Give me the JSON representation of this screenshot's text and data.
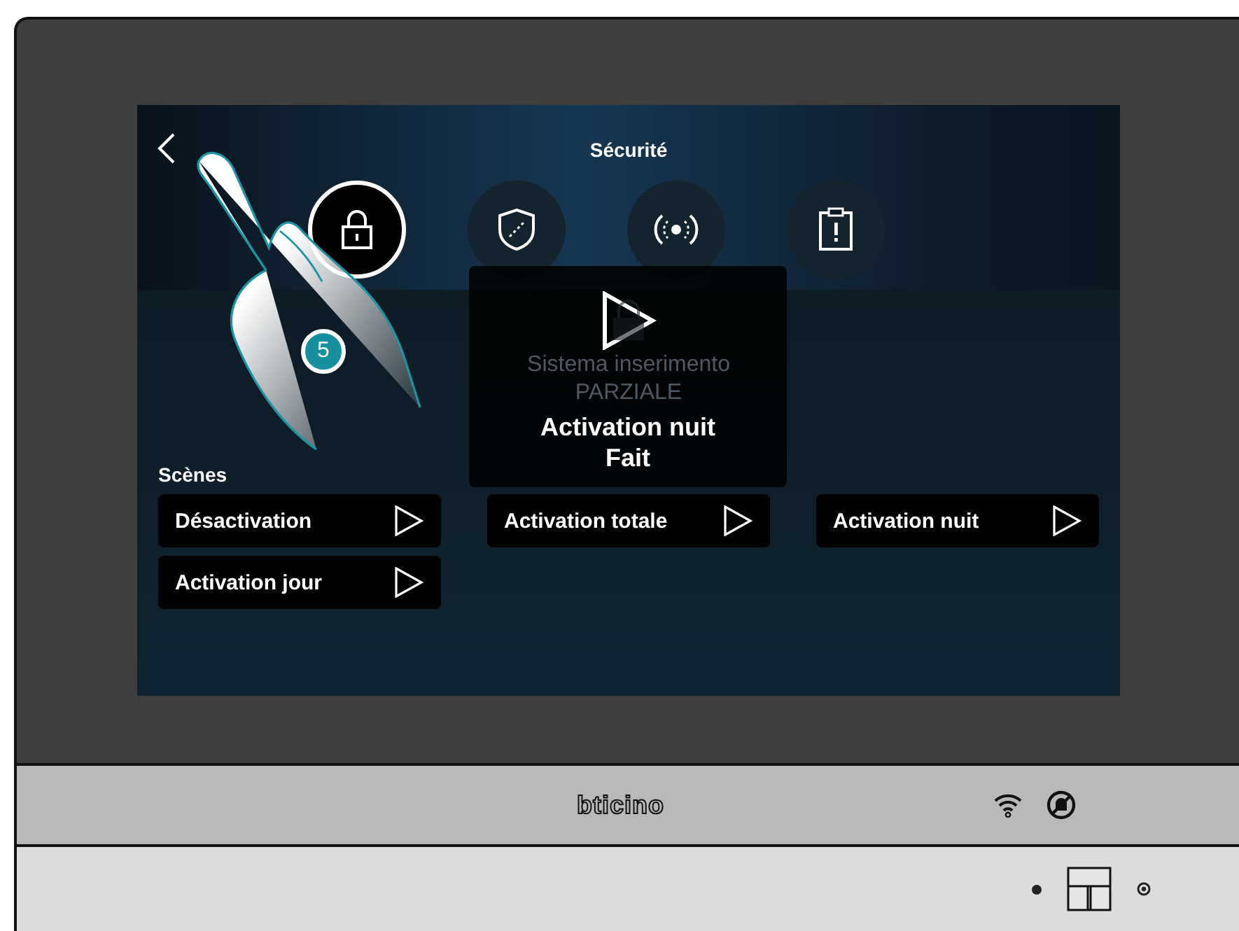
{
  "screen": {
    "title": "Sécurité",
    "tabs": [
      {
        "kind": "lock",
        "selected": true
      },
      {
        "kind": "shield",
        "selected": false
      },
      {
        "kind": "signal",
        "selected": false
      },
      {
        "kind": "log",
        "selected": false
      }
    ],
    "status_lines": [
      "Sistema inserimento",
      "PARZIALE"
    ],
    "scenes": {
      "title": "Scènes",
      "items": [
        {
          "label": "Désactivation"
        },
        {
          "label": "Activation totale"
        },
        {
          "label": "Activation nuit"
        },
        {
          "label": "Activation jour"
        }
      ]
    },
    "popup": {
      "lines": [
        "Activation nuit",
        "Fait"
      ]
    }
  },
  "step_badge": "5",
  "device": {
    "logo": "bticino"
  }
}
